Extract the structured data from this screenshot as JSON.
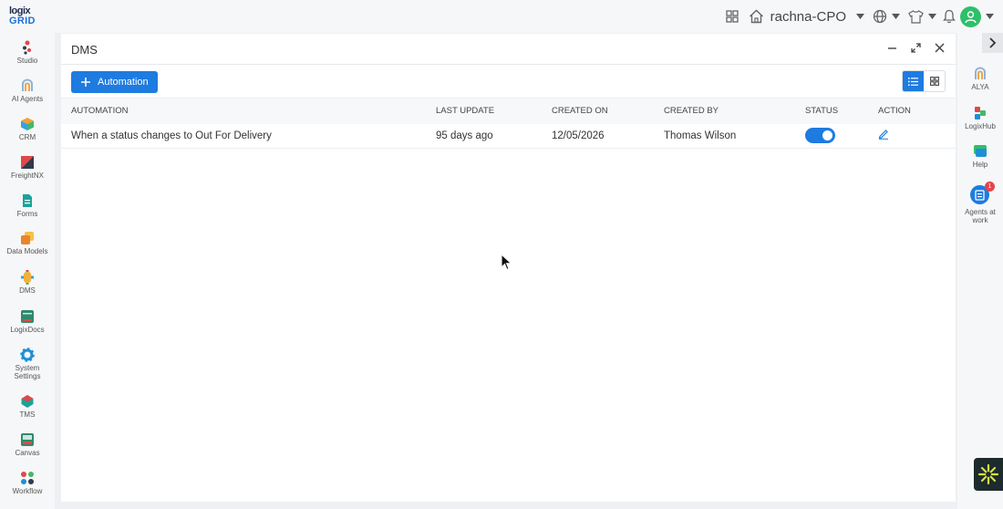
{
  "logo": {
    "line1": "logix",
    "line2": "GRID"
  },
  "header": {
    "user_name": "rachna-CPO"
  },
  "sidebar": {
    "items": [
      {
        "label": "Studio"
      },
      {
        "label": "AI Agents"
      },
      {
        "label": "CRM"
      },
      {
        "label": "FreightNX"
      },
      {
        "label": "Forms"
      },
      {
        "label": "Data Models"
      },
      {
        "label": "DMS"
      },
      {
        "label": "LogixDocs"
      },
      {
        "label": "System Settings"
      },
      {
        "label": "TMS"
      },
      {
        "label": "Canvas"
      },
      {
        "label": "Workflow"
      }
    ]
  },
  "right_sidebar": {
    "items": [
      {
        "label": "ALYA"
      },
      {
        "label": "LogixHub"
      },
      {
        "label": "Help"
      },
      {
        "label": "Agents at work",
        "badge": "1"
      }
    ]
  },
  "panel": {
    "title": "DMS",
    "add_button_label": "Automation",
    "columns": [
      "AUTOMATION",
      "LAST UPDATE",
      "CREATED ON",
      "CREATED BY",
      "STATUS",
      "ACTION"
    ],
    "rows": [
      {
        "automation": "When a status changes to Out For Delivery",
        "last_update": "95 days ago",
        "created_on": "12/05/2026",
        "created_by": "Thomas Wilson",
        "status_on": true
      }
    ]
  },
  "colors": {
    "accent": "#1e7be0",
    "avatar": "#2fbf6a",
    "badge": "#e5434b"
  }
}
